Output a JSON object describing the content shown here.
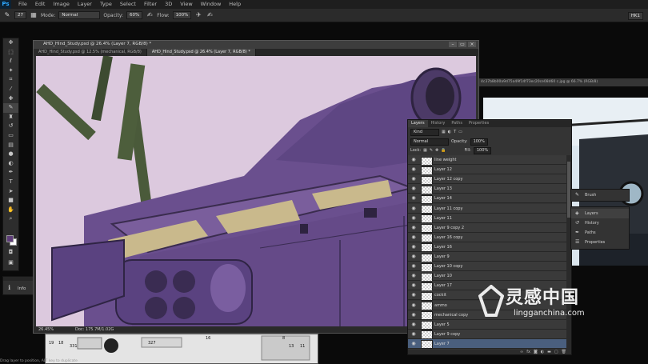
{
  "app": {
    "logo": "Ps"
  },
  "menu": [
    "File",
    "Edit",
    "Image",
    "Layer",
    "Type",
    "Select",
    "Filter",
    "3D",
    "View",
    "Window",
    "Help"
  ],
  "options_bar": {
    "brush_size": "27",
    "mode_label": "Mode:",
    "mode_value": "Normal",
    "opacity_label": "Opacity:",
    "opacity_value": "60%",
    "flow_label": "Flow:",
    "flow_value": "100%",
    "workspace": "HK1"
  },
  "tools": [
    "move-icon",
    "marquee-icon",
    "lasso-icon",
    "quick-select-icon",
    "crop-icon",
    "eyedropper-icon",
    "healing-icon",
    "brush-icon",
    "stamp-icon",
    "history-brush-icon",
    "eraser-icon",
    "gradient-icon",
    "blur-icon",
    "dodge-icon",
    "pen-icon",
    "type-icon",
    "path-select-icon",
    "shape-icon",
    "hand-icon",
    "zoom-icon"
  ],
  "colors": {
    "foreground": "#5d3c78",
    "background": "#ffffff",
    "canvas": "#d8c4da",
    "heli_body": "#6a4f8e",
    "accent_tan": "#c9b98c",
    "selection": "#4a5f7e"
  },
  "info_panel": {
    "label": "Info"
  },
  "document": {
    "title": "AHD_Hind_Study.psd @ 26.4% (Layer 7, RGB/8) *",
    "tabs": [
      {
        "label": "AHD_Hind_Study.psd @ 12.5% (mechanical, RGB/8)"
      },
      {
        "label": "AHD_Hind_Study.psd @ 26.4% (Layer 7, RGB/8) *"
      }
    ],
    "zoom": "26.45%",
    "doc_info": "Doc: 175.7M/1.02G"
  },
  "reference_strip": {
    "title": "4c37b8b00a9d75a49f14f73ec20ce08d60 c.jpg @ 66.7% (RGB/8)"
  },
  "bottom_ref_numbers": [
    "19",
    "18",
    "331",
    "327",
    "16",
    "8",
    "13",
    "11"
  ],
  "bottom_status": "Drag layer to position, ALT key to duplicate",
  "layers_panel": {
    "tabs": [
      "Layers",
      "History",
      "Paths",
      "Properties"
    ],
    "kind_label": "Kind",
    "blend_mode": "Normal",
    "opacity_label": "Opacity:",
    "opacity_value": "100%",
    "lock_label": "Lock:",
    "fill_label": "Fill:",
    "fill_value": "100%",
    "layers": [
      {
        "name": "line weight"
      },
      {
        "name": "Layer 12"
      },
      {
        "name": "Layer 12 copy"
      },
      {
        "name": "Layer 13"
      },
      {
        "name": "Layer 14"
      },
      {
        "name": "Layer 11 copy"
      },
      {
        "name": "Layer 11"
      },
      {
        "name": "Layer 9 copy 2"
      },
      {
        "name": "Layer 16 copy"
      },
      {
        "name": "Layer 16"
      },
      {
        "name": "Layer 9"
      },
      {
        "name": "Layer 10 copy"
      },
      {
        "name": "Layer 10"
      },
      {
        "name": "Layer 17"
      },
      {
        "name": "cockit"
      },
      {
        "name": "ammo"
      },
      {
        "name": "mechanical copy"
      },
      {
        "name": "Layer 5"
      },
      {
        "name": "Layer 9 copy"
      },
      {
        "name": "Layer 7"
      }
    ],
    "selected_index": 19
  },
  "side_panels": {
    "brush": "Brush",
    "stack": [
      {
        "icon": "layers-icon",
        "label": "Layers"
      },
      {
        "icon": "history-icon",
        "label": "History"
      },
      {
        "icon": "paths-icon",
        "label": "Paths"
      },
      {
        "icon": "properties-icon",
        "label": "Properties"
      }
    ]
  },
  "watermark": {
    "cn": "灵感中国",
    "en": "lingganchina.com"
  }
}
